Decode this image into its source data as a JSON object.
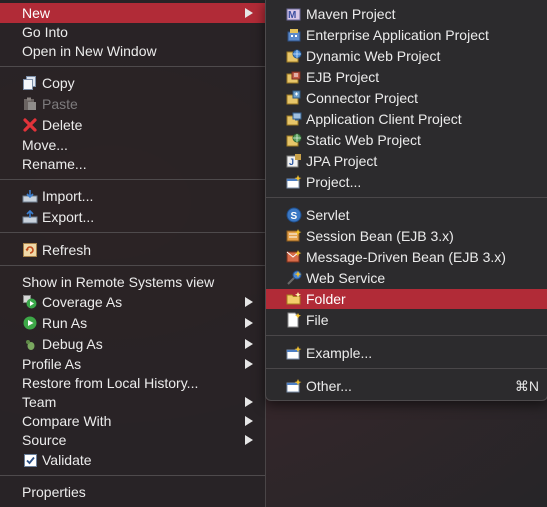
{
  "menu": {
    "new": "New",
    "go_into": "Go Into",
    "open_new_window": "Open in New Window",
    "copy": "Copy",
    "paste": "Paste",
    "delete": "Delete",
    "move": "Move...",
    "rename": "Rename...",
    "import": "Import...",
    "export": "Export...",
    "refresh": "Refresh",
    "show_remote": "Show in Remote Systems view",
    "coverage_as": "Coverage As",
    "run_as": "Run As",
    "debug_as": "Debug As",
    "profile_as": "Profile As",
    "restore_history": "Restore from Local History...",
    "team": "Team",
    "compare_with": "Compare With",
    "source": "Source",
    "validate": "Validate",
    "properties": "Properties"
  },
  "submenu": {
    "maven_project": "Maven Project",
    "enterprise_app_project": "Enterprise Application Project",
    "dynamic_web_project": "Dynamic Web Project",
    "ejb_project": "EJB Project",
    "connector_project": "Connector Project",
    "app_client_project": "Application Client Project",
    "static_web_project": "Static Web Project",
    "jpa_project": "JPA Project",
    "project": "Project...",
    "servlet": "Servlet",
    "session_bean": "Session Bean (EJB 3.x)",
    "mdb": "Message-Driven Bean (EJB 3.x)",
    "web_service": "Web Service",
    "folder": "Folder",
    "file": "File",
    "example": "Example...",
    "other": "Other...",
    "other_shortcut": "⌘N"
  },
  "colors": {
    "selection": "#b12b37",
    "menu_bg": "#2b282a",
    "text": "#ececec",
    "disabled_text": "#7d7b7d"
  }
}
